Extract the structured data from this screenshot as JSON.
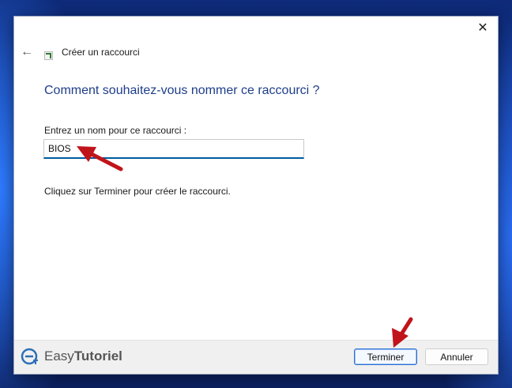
{
  "dialog": {
    "close_glyph": "✕",
    "back_glyph": "←",
    "title": "Créer un raccourci",
    "question": "Comment souhaitez-vous nommer ce raccourci ?",
    "name_label": "Entrez un nom pour ce raccourci :",
    "name_value": "BIOS",
    "hint": "Cliquez sur Terminer pour créer le raccourci."
  },
  "footer": {
    "brand_prefix": "Easy",
    "brand_suffix": "Tutoriel",
    "finish_label": "Terminer",
    "cancel_label": "Annuler"
  },
  "colors": {
    "annotation_arrow": "#c0141a",
    "question_text": "#1e3d8a",
    "input_underline": "#005a9e"
  }
}
